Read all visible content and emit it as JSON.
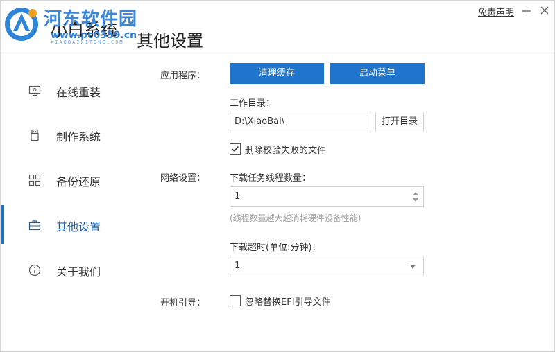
{
  "titlebar": {
    "watermark_text": "河东软件园",
    "watermark_url": "www.pc0359.cn",
    "app_name": "小白系统",
    "brand_subtitle": "XIAOBAIXITONG.COM",
    "page_heading": "其他设置",
    "disclaimer_label": "免责声明",
    "minimize_icon": "minimize-icon",
    "close_icon": "close-icon"
  },
  "sidebar": {
    "items": [
      {
        "label": "在线重装",
        "icon": "monitor-icon",
        "active": false
      },
      {
        "label": "制作系统",
        "icon": "usb-drive-icon",
        "active": false
      },
      {
        "label": "备份还原",
        "icon": "grid-icon",
        "active": false
      },
      {
        "label": "其他设置",
        "icon": "briefcase-icon",
        "active": true
      },
      {
        "label": "关于我们",
        "icon": "info-icon",
        "active": false
      }
    ]
  },
  "settings": {
    "apps_label": "应用程序：",
    "clear_cache_label": "清理缓存",
    "boot_menu_label": "启动菜单",
    "workdir_label": "工作目录：",
    "workdir_value": "D:\\XiaoBai\\",
    "open_dir_label": "打开目录",
    "delete_failed_label": "删除校验失败的文件",
    "delete_failed_checked": true,
    "network_label": "网络设置：",
    "threads_label": "下载任务线程数量：",
    "threads_value": "1",
    "threads_hint": "(线程数量越大越消耗硬件设备性能)",
    "timeout_label": "下载超时(单位:分钟)：",
    "timeout_value": "1",
    "boot_label": "开机引导：",
    "ignore_efi_label": "忽略替换EFI引导文件",
    "ignore_efi_checked": false
  },
  "colors": {
    "accent": "#1f75cc",
    "active_bar": "#1e73c8",
    "hint": "#a0a0a0"
  }
}
